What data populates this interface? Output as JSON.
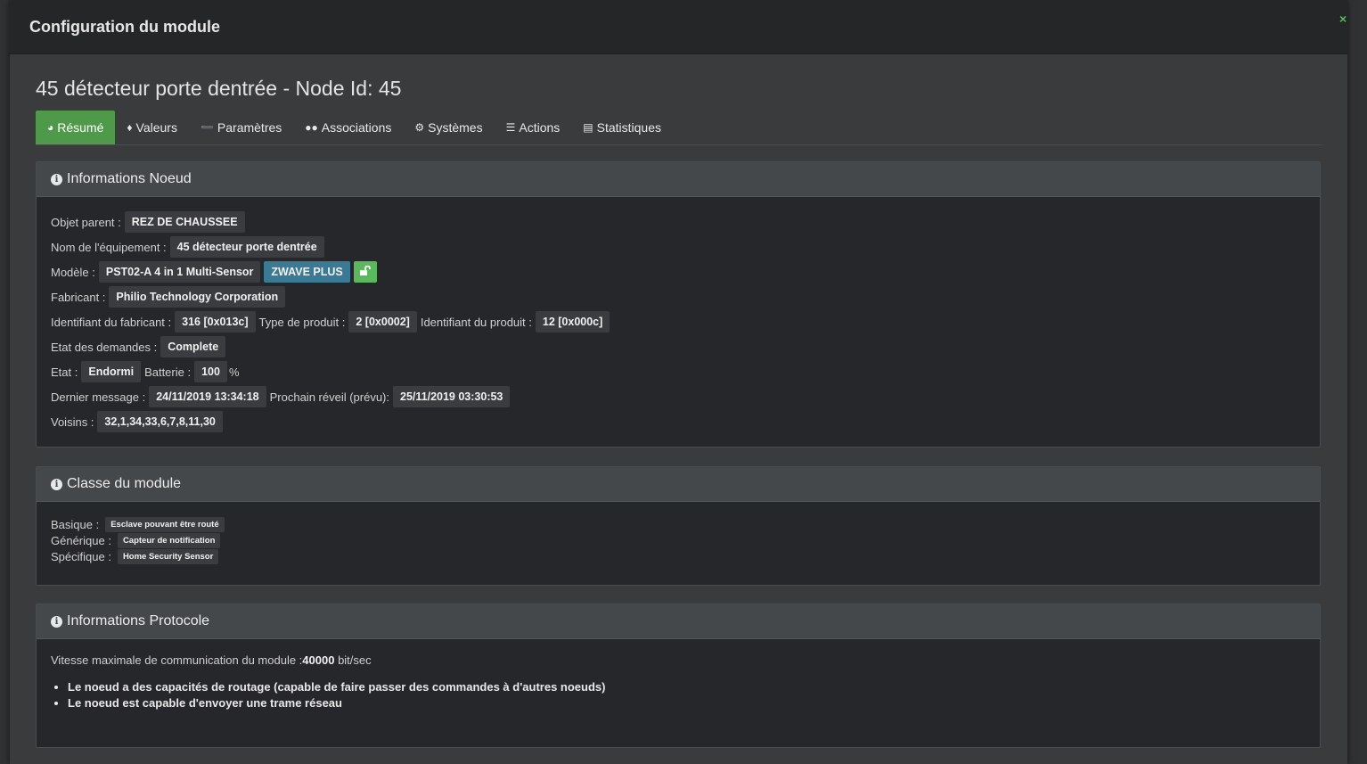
{
  "modal": {
    "title": "Configuration du module",
    "close_label": "×"
  },
  "node_title": "45 détecteur porte dentrée - Node Id: 45",
  "tabs": [
    {
      "label": "Résumé",
      "icon": "dashboard-icon"
    },
    {
      "label": "Valeurs",
      "icon": "tag-icon"
    },
    {
      "label": "Paramètres",
      "icon": "wrench-icon"
    },
    {
      "label": "Associations",
      "icon": "users-icon"
    },
    {
      "label": "Systèmes",
      "icon": "cogs-icon"
    },
    {
      "label": "Actions",
      "icon": "sliders-icon"
    },
    {
      "label": "Statistiques",
      "icon": "bar-chart-icon"
    }
  ],
  "info_noeud": {
    "heading": "Informations Noeud",
    "objet_parent_label": "Objet parent :",
    "objet_parent": "REZ DE CHAUSSEE",
    "nom_label": "Nom de l'équipement :",
    "nom": "45 détecteur porte dentrée",
    "modele_label": "Modèle :",
    "modele": "PST02-A 4 in 1 Multi-Sensor",
    "zwave_plus": "ZWAVE PLUS",
    "fabricant_label": "Fabricant :",
    "fabricant": "Philio Technology Corporation",
    "id_fabricant_label": "Identifiant du fabricant :",
    "id_fabricant": "316 [0x013c]",
    "type_produit_label": "Type de produit :",
    "type_produit": "2 [0x0002]",
    "id_produit_label": "Identifiant du produit :",
    "id_produit": "12 [0x000c]",
    "etat_demandes_label": "Etat des demandes :",
    "etat_demandes": "Complete",
    "etat_label": "Etat :",
    "etat": "Endormi",
    "batterie_label": "Batterie :",
    "batterie": "100",
    "batterie_unit": "%",
    "dernier_message_label": "Dernier message :",
    "dernier_message": "24/11/2019 13:34:18",
    "prochain_reveil_label": "Prochain réveil (prévu):",
    "prochain_reveil": "25/11/2019 03:30:53",
    "voisins_label": "Voisins :",
    "voisins": "32,1,34,33,6,7,8,11,30"
  },
  "classe": {
    "heading": "Classe du module",
    "basique_label": "Basique :",
    "basique": "Esclave pouvant être routé",
    "generique_label": "Générique :",
    "generique": "Capteur de notification",
    "specifique_label": "Spécifique :",
    "specifique": "Home Security Sensor"
  },
  "protocole": {
    "heading": "Informations Protocole",
    "vitesse_label": "Vitesse maximale de communication du module :",
    "vitesse_value": "40000",
    "vitesse_unit": " bit/sec",
    "capacites": [
      "Le noeud a des capacités de routage (capable de faire passer des commandes à d'autres noeuds)",
      "Le noeud est capable d'envoyer une trame réseau"
    ]
  },
  "colors": {
    "active_tab": "#4f9a4a",
    "zwave_badge": "#3a7a94",
    "lock_badge": "#5cb85c"
  }
}
